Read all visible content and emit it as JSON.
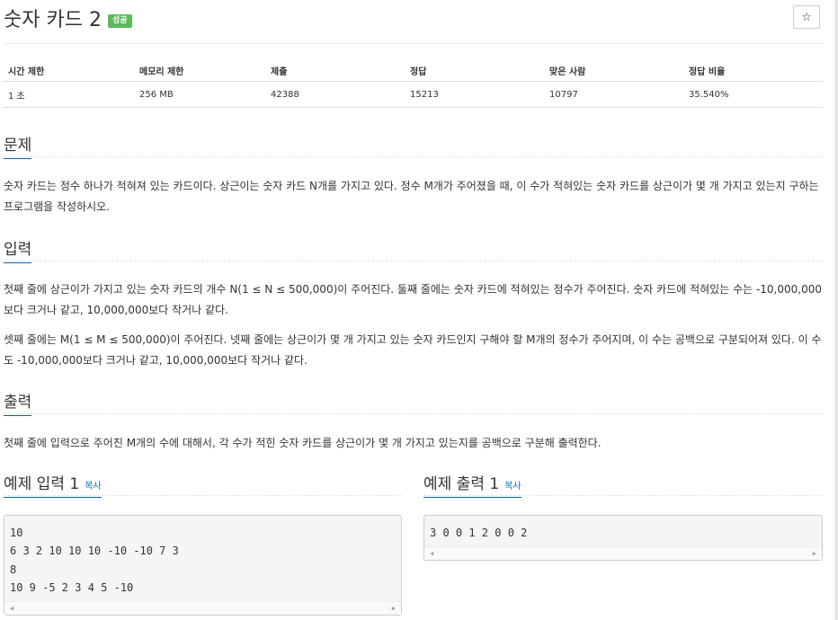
{
  "header": {
    "title": "숫자 카드 2",
    "badge": "성공",
    "star_icon": "☆"
  },
  "info_table": {
    "headers": [
      "시간 제한",
      "메모리 제한",
      "제출",
      "정답",
      "맞은 사람",
      "정답 비율"
    ],
    "values": [
      "1 초",
      "256 MB",
      "42388",
      "15213",
      "10797",
      "35.540%"
    ]
  },
  "problem": {
    "title": "문제",
    "text": "숫자 카드는 정수 하나가 적혀져 있는 카드이다. 상근이는 숫자 카드 N개를 가지고 있다. 정수 M개가 주어졌을 때, 이 수가 적혀있는 숫자 카드를 상근이가 몇 개 가지고 있는지 구하는 프로그램을 작성하시오."
  },
  "input": {
    "title": "입력",
    "paragraphs": [
      "첫째 줄에 상근이가 가지고 있는 숫자 카드의 개수 N(1 ≤ N ≤ 500,000)이 주어진다. 둘째 줄에는 숫자 카드에 적혀있는 정수가 주어진다. 숫자 카드에 적혀있는 수는 -10,000,000보다 크거나 같고, 10,000,000보다 작거나 같다.",
      "셋째 줄에는 M(1 ≤ M ≤ 500,000)이 주어진다. 넷째 줄에는 상근이가 몇 개 가지고 있는 숫자 카드인지 구해야 할 M개의 정수가 주어지며, 이 수는 공백으로 구분되어져 있다. 이 수도 -10,000,000보다 크거나 같고, 10,000,000보다 작거나 같다."
    ]
  },
  "output": {
    "title": "출력",
    "text": "첫째 줄에 입력으로 주어진 M개의 수에 대해서, 각 수가 적힌 숫자 카드를 상근이가 몇 개 가지고 있는지를 공백으로 구분해 출력한다."
  },
  "sample_input": {
    "title": "예제 입력 1",
    "copy_label": "복사",
    "lines": [
      "10",
      "6 3 2 10 10 10 -10 -10 7 3",
      "8",
      "10 9 -5 2 3 4 5 -10"
    ]
  },
  "sample_output": {
    "title": "예제 출력 1",
    "copy_label": "복사",
    "lines": [
      "3 0 0 1 2 0 0 2"
    ]
  },
  "scroll": {
    "left_arrow": "◀",
    "right_arrow": "▶"
  }
}
